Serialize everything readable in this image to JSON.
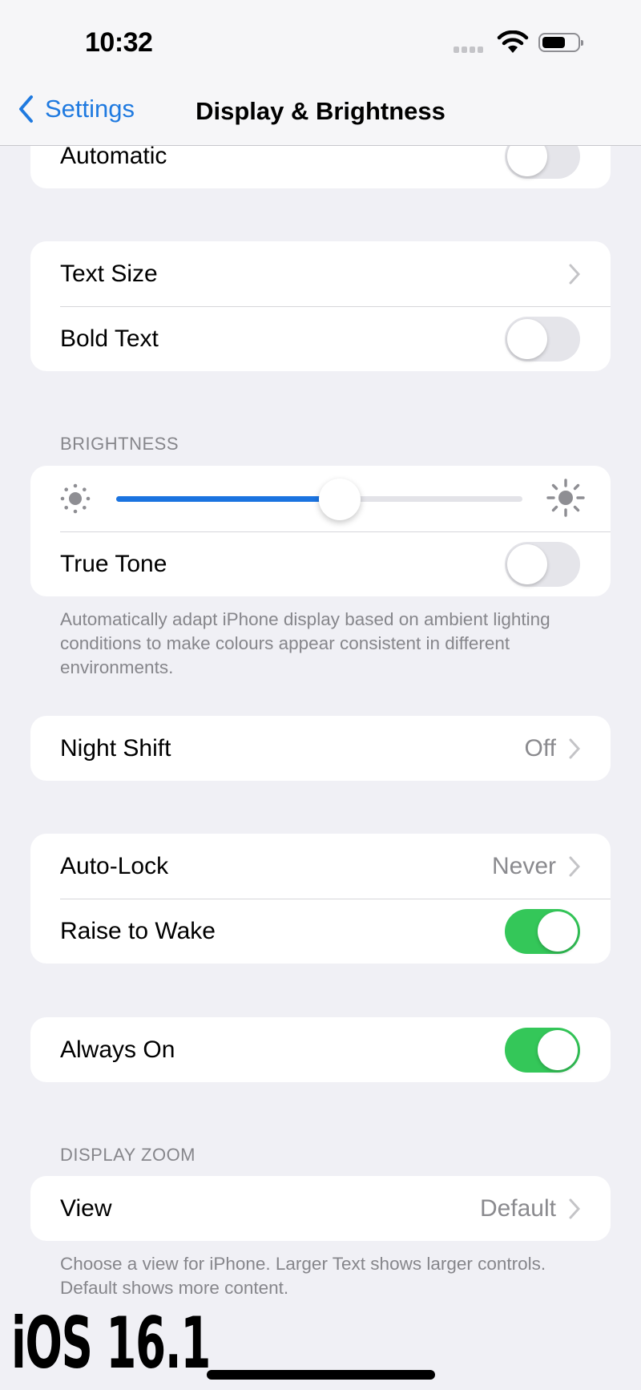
{
  "status_bar": {
    "time": "10:32",
    "icons": [
      "cellular-signal-icon",
      "wifi-icon",
      "battery-icon"
    ]
  },
  "nav": {
    "back_label": "Settings",
    "title": "Display & Brightness"
  },
  "sections": {
    "appearance": {
      "automatic": {
        "label": "Automatic",
        "toggle": false
      }
    },
    "text": {
      "text_size": {
        "label": "Text Size"
      },
      "bold_text": {
        "label": "Bold Text",
        "toggle": false
      }
    },
    "brightness": {
      "header": "BRIGHTNESS",
      "level": 0.55,
      "true_tone": {
        "label": "True Tone",
        "toggle": false
      },
      "footer": "Automatically adapt iPhone display based on ambient lighting conditions to make colours appear consistent in different environments."
    },
    "night_shift": {
      "label": "Night Shift",
      "value": "Off"
    },
    "lock": {
      "auto_lock": {
        "label": "Auto-Lock",
        "value": "Never"
      },
      "raise_to_wake": {
        "label": "Raise to Wake",
        "toggle": true
      }
    },
    "always_on": {
      "label": "Always On",
      "toggle": true
    },
    "display_zoom": {
      "header": "DISPLAY ZOOM",
      "view": {
        "label": "View",
        "value": "Default"
      },
      "footer": "Choose a view for iPhone. Larger Text shows larger controls. Default shows more content."
    }
  },
  "chevron": "›",
  "watermark": "iOS 16.1",
  "colors": {
    "accent": "#1f7ae0",
    "toggle_on": "#34c759",
    "background": "#f0f0f5"
  }
}
